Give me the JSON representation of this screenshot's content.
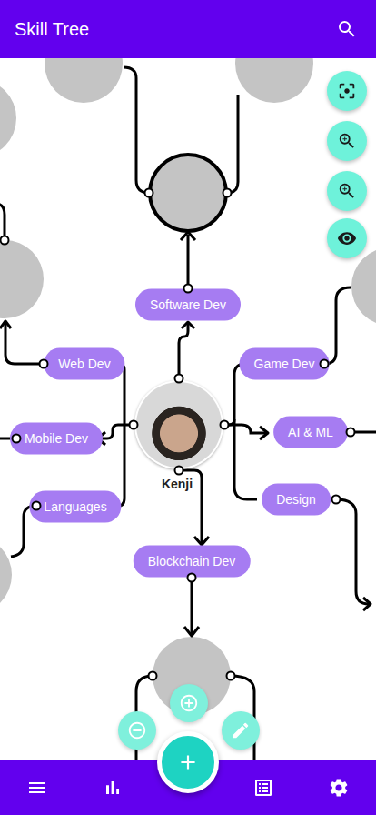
{
  "app_bar": {
    "title": "Skill Tree"
  },
  "user": {
    "name": "Kenji"
  },
  "skills": [
    {
      "label": "Software Dev"
    },
    {
      "label": "Web Dev"
    },
    {
      "label": "Mobile Dev"
    },
    {
      "label": "Languages"
    },
    {
      "label": "Game Dev"
    },
    {
      "label": "AI & ML"
    },
    {
      "label": "Design"
    },
    {
      "label": "Blockchain Dev"
    }
  ],
  "nodes": [
    {
      "selected": false
    },
    {
      "selected": false
    },
    {
      "selected": false
    },
    {
      "selected": true
    },
    {
      "selected": false
    },
    {
      "selected": false
    },
    {
      "selected": false
    },
    {
      "selected": false
    }
  ]
}
